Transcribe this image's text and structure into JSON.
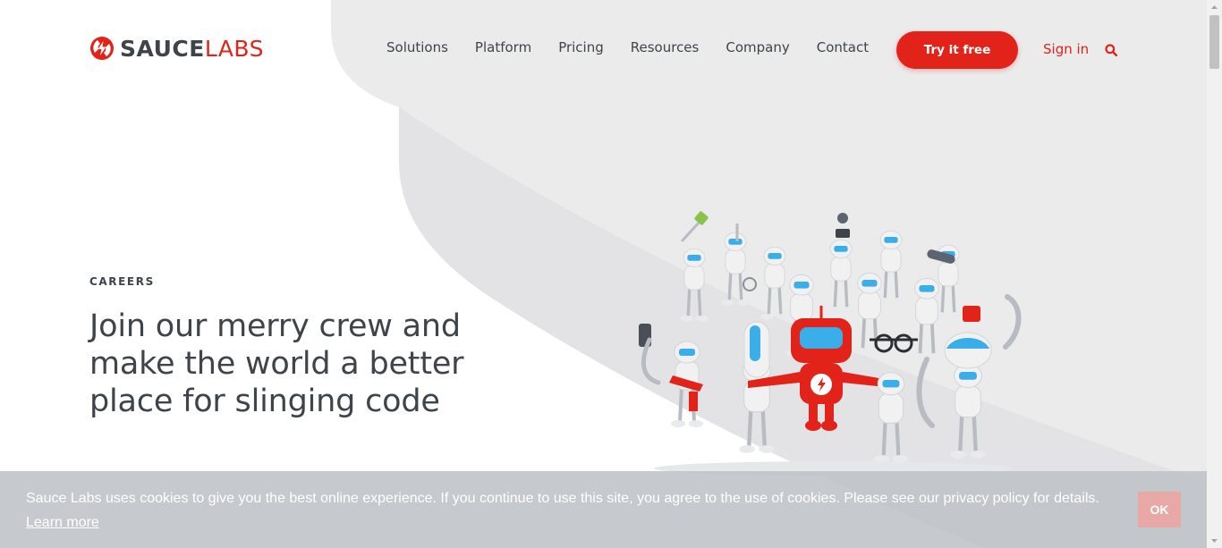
{
  "brand": {
    "name_part1": "SAUCE",
    "name_part2": "LABS",
    "accent_color": "#e2231a",
    "icon": "sauce-labs-bolt-icon"
  },
  "nav": {
    "items": [
      "Solutions",
      "Platform",
      "Pricing",
      "Resources",
      "Company",
      "Contact"
    ],
    "cta_label": "Try it free",
    "signin_label": "Sign in",
    "search_icon": "search-icon"
  },
  "hero": {
    "eyebrow": "CAREERS",
    "headline": "Join our merry crew and make the world a better place for slinging code",
    "illustration": "robot-crew-illustration"
  },
  "cookie_banner": {
    "text": "Sauce Labs uses cookies to give you the best online experience. If you continue to use this site, you agree to the use of cookies. Please see our privacy policy for details.",
    "link_label": "Learn more",
    "ok_label": "OK"
  }
}
